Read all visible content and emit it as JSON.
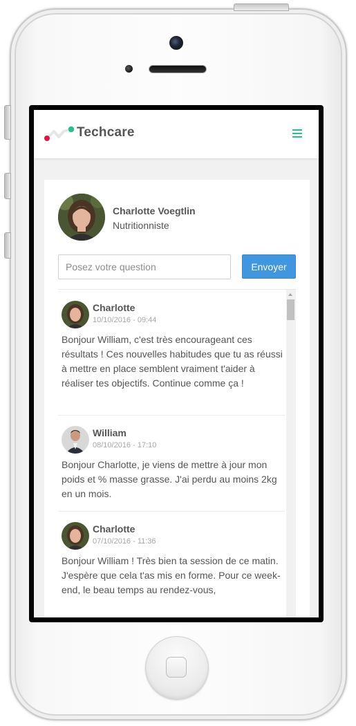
{
  "app": {
    "brand": "Techcare",
    "accent_color": "#22c38e",
    "logo_red": "#e2173d"
  },
  "navbar": {
    "menu_icon": "hamburger-menu-icon"
  },
  "profile": {
    "name": "Charlotte Voegtlin",
    "role": "Nutritionniste"
  },
  "question": {
    "placeholder": "Posez votre question",
    "value": "",
    "send_label": "Envoyer",
    "send_color": "#4196e0"
  },
  "messages": [
    {
      "author": "Charlotte",
      "date": "10/10/2016 - 09:44",
      "text": "Bonjour William, c'est très encourageant ces résultats ! Ces nouvelles habitudes que tu as réussi à mettre en place semblent vraiment t'aider à réaliser tes objectifs. Continue comme ça !"
    },
    {
      "author": "William",
      "date": "08/10/2016 - 17:10",
      "text": "Bonjour Charlotte, je viens de mettre à jour mon poids et % masse grasse. J'ai perdu au moins 2kg en un mois."
    },
    {
      "author": "Charlotte",
      "date": "07/10/2016 - 11:36",
      "text": "Bonjour William ! Très bien ta session de ce matin. J'espère que cela t'as mis en forme. Pour ce week-end, le beau temps au rendez-vous,"
    }
  ]
}
